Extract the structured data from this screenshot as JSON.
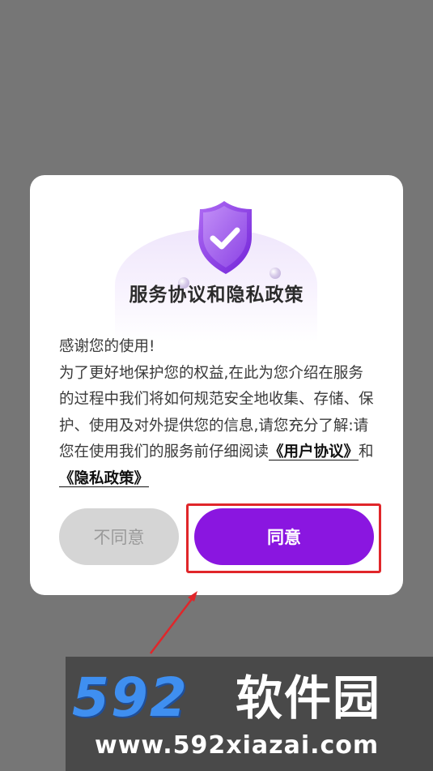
{
  "dialog": {
    "title": "服务协议和隐私政策",
    "body": {
      "line1": "感谢您的使用!",
      "paragraph": "为了更好地保护您的权益,在此为您介绍在服务的过程中我们将如何规范安全地收集、存储、保护、使用及对外提供您的信息,请您充分了解:请您在使用我们的服务前仔细阅读",
      "link_user_agreement": "《用户协议》",
      "connector": "和",
      "link_privacy_policy": "《隐私政策》"
    },
    "buttons": {
      "disagree_label": "不同意",
      "agree_label": "同意"
    }
  },
  "watermark": {
    "logo_number": "592",
    "brand": "软件园",
    "url": "www.592xiazai.com"
  },
  "colors": {
    "overlay": "#767676",
    "accent_purple": "#8a16e0",
    "highlight_red": "#e0262a"
  },
  "icons": [
    "shield-check-icon",
    "annotation-arrow"
  ]
}
